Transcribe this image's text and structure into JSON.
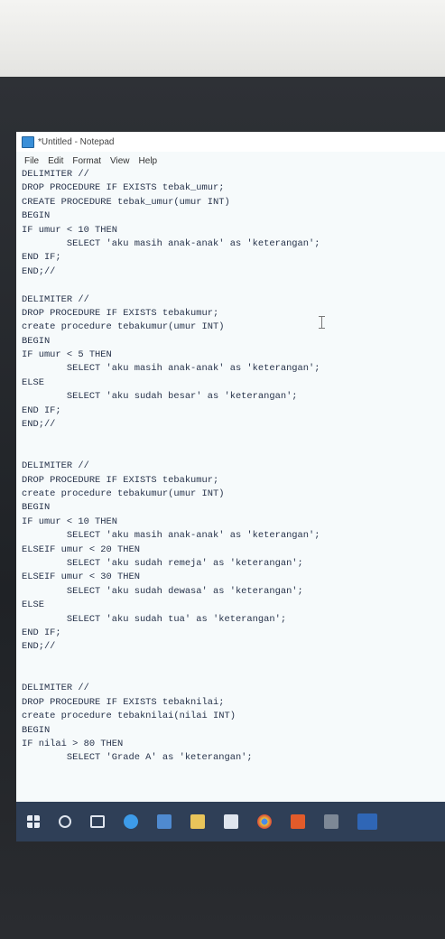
{
  "window": {
    "title": "*Untitled - Notepad"
  },
  "menu": [
    "File",
    "Edit",
    "Format",
    "View",
    "Help"
  ],
  "editor": {
    "lines": [
      "DELIMITER //",
      "DROP PROCEDURE IF EXISTS tebak_umur;",
      "CREATE PROCEDURE tebak_umur(umur INT)",
      "BEGIN",
      "IF umur < 10 THEN",
      "        SELECT 'aku masih anak-anak' as 'keterangan';",
      "END IF;",
      "END;//",
      "",
      "DELIMITER //",
      "DROP PROCEDURE IF EXISTS tebakumur;",
      "create procedure tebakumur(umur INT)",
      "BEGIN",
      "IF umur < 5 THEN",
      "        SELECT 'aku masih anak-anak' as 'keterangan';",
      "ELSE",
      "        SELECT 'aku sudah besar' as 'keterangan';",
      "END IF;",
      "END;//",
      "",
      "",
      "DELIMITER //",
      "DROP PROCEDURE IF EXISTS tebakumur;",
      "create procedure tebakumur(umur INT)",
      "BEGIN",
      "IF umur < 10 THEN",
      "        SELECT 'aku masih anak-anak' as 'keterangan';",
      "ELSEIF umur < 20 THEN",
      "        SELECT 'aku sudah remeja' as 'keterangan';",
      "ELSEIF umur < 30 THEN",
      "        SELECT 'aku sudah dewasa' as 'keterangan';",
      "ELSE",
      "        SELECT 'aku sudah tua' as 'keterangan';",
      "END IF;",
      "END;//",
      "",
      "",
      "DELIMITER //",
      "DROP PROCEDURE IF EXISTS tebaknilai;",
      "create procedure tebaknilai(nilai INT)",
      "BEGIN",
      "IF nilai > 80 THEN",
      "        SELECT 'Grade A' as 'keterangan';"
    ]
  },
  "taskbar": {
    "icons": [
      "windows-start-icon",
      "search-icon",
      "task-view-icon",
      "edge-icon",
      "store-icon",
      "file-explorer-icon",
      "mail-icon",
      "chrome-icon",
      "office-icon",
      "app-icon",
      "word-icon"
    ]
  }
}
